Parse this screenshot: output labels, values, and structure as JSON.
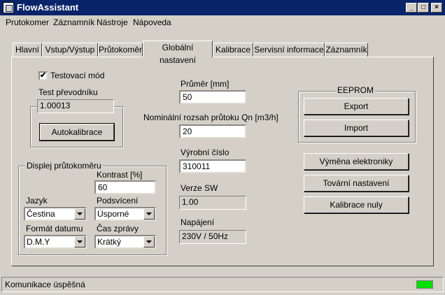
{
  "window": {
    "title": "FlowAssistant"
  },
  "menu": [
    {
      "label": "Prutokomer"
    },
    {
      "label": "Záznamník"
    },
    {
      "label": "Nástroje"
    },
    {
      "label": "Nápoveda"
    }
  ],
  "tabs": [
    {
      "label": "Hlavní"
    },
    {
      "label": "Vstup/Výstup"
    },
    {
      "label": "Průtokoměr"
    },
    {
      "label": "Globální nastavení"
    },
    {
      "label": "Kalibrace"
    },
    {
      "label": "Servisní informace"
    },
    {
      "label": "Záznamník"
    }
  ],
  "active_tab": "Globální nastavení",
  "test_mode": {
    "label": "Testovací mód",
    "checked": "✔"
  },
  "converter_test": {
    "label": "Test převodníku",
    "value": "1.00013",
    "button": "Autokalibrace"
  },
  "display": {
    "title": "Displej průtokoměru",
    "contrast_label": "Kontrast [%]",
    "contrast_value": "60",
    "language_label": "Jazyk",
    "language_value": "Čestina",
    "backlight_label": "Podsvícení",
    "backlight_value": "Úsporné",
    "date_label": "Formát datumu",
    "date_value": "D.M.Y",
    "msg_label": "Čas zprávy",
    "msg_value": "Krátký"
  },
  "diameter": {
    "label": "Průměr [mm]",
    "value": "50"
  },
  "nominal": {
    "label": "Nominální rozsah průtoku Qn [m3/h]",
    "value": "20"
  },
  "serial": {
    "label": "Výrobní číslo",
    "value": "310011"
  },
  "sw": {
    "label": "Verze SW",
    "value": "1.00"
  },
  "power": {
    "label": "Napájení",
    "value": "230V / 50Hz"
  },
  "eeprom": {
    "title": "EEPROM",
    "export": "Export",
    "import": "Import"
  },
  "buttons": {
    "replace": "Výměna elektroniky",
    "factory": "Tovární nastavení",
    "zero": "Kalibrace nuly"
  },
  "status": {
    "text": "Komunikace úspěšná",
    "led_color": "#00e000"
  },
  "window_controls": {
    "minimize": "_",
    "maximize": "□",
    "close": "×"
  }
}
